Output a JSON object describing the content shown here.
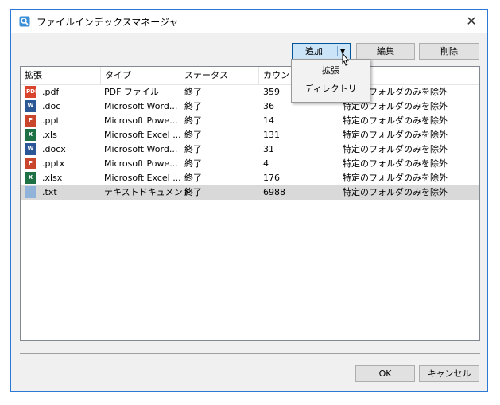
{
  "window": {
    "title": "ファイルインデックスマネージャ"
  },
  "toolbar": {
    "add_label": "追加",
    "edit_label": "編集",
    "delete_label": "削除"
  },
  "columns": [
    {
      "label": "拡張"
    },
    {
      "label": "タイプ"
    },
    {
      "label": "ステータス"
    },
    {
      "label": "カウント"
    },
    {
      "label": ""
    }
  ],
  "rows": [
    {
      "ext": ".pdf",
      "type": "PDF ファイル",
      "status": "終了",
      "count": "359",
      "exclude": "特定のフォルダのみを除外",
      "icon": "pdf-file-icon",
      "color": "#d9442c",
      "glyph": "PDF"
    },
    {
      "ext": ".doc",
      "type": "Microsoft Word...",
      "status": "終了",
      "count": "36",
      "exclude": "特定のフォルダのみを除外",
      "icon": "word-file-icon",
      "color": "#2b5797",
      "glyph": "W"
    },
    {
      "ext": ".ppt",
      "type": "Microsoft Powe...",
      "status": "終了",
      "count": "14",
      "exclude": "特定のフォルダのみを除外",
      "icon": "powerpoint-file-icon",
      "color": "#c9462c",
      "glyph": "P"
    },
    {
      "ext": ".xls",
      "type": "Microsoft Excel ...",
      "status": "終了",
      "count": "131",
      "exclude": "特定のフォルダのみを除外",
      "icon": "excel-file-icon",
      "color": "#1e7145",
      "glyph": "X"
    },
    {
      "ext": ".docx",
      "type": "Microsoft Word...",
      "status": "終了",
      "count": "31",
      "exclude": "特定のフォルダのみを除外",
      "icon": "word-file-icon",
      "color": "#2b5797",
      "glyph": "W"
    },
    {
      "ext": ".pptx",
      "type": "Microsoft Powe...",
      "status": "終了",
      "count": "4",
      "exclude": "特定のフォルダのみを除外",
      "icon": "powerpoint-file-icon",
      "color": "#c9462c",
      "glyph": "P"
    },
    {
      "ext": ".xlsx",
      "type": "Microsoft Excel ...",
      "status": "終了",
      "count": "176",
      "exclude": "特定のフォルダのみを除外",
      "icon": "excel-file-icon",
      "color": "#1e7145",
      "glyph": "X"
    },
    {
      "ext": ".txt",
      "type": "テキストドキュメント",
      "status": "終了",
      "count": "6988",
      "exclude": "特定のフォルダのみを除外",
      "icon": "text-file-icon",
      "color": "#8fb3d9",
      "glyph": ""
    }
  ],
  "add_menu": {
    "items": [
      "拡張",
      "ディレクトリ"
    ]
  },
  "footer": {
    "ok_label": "OK",
    "cancel_label": "キャンセル"
  },
  "colors": {
    "title_border": "#2b79d4",
    "selected_row": "#d9d9d9",
    "active_button": "#cce4f7"
  }
}
